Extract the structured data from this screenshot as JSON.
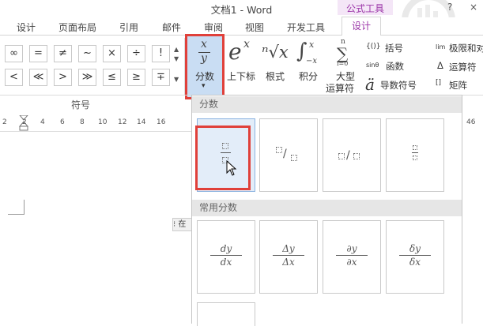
{
  "window": {
    "title": "文档1 - Word",
    "minimize": "?",
    "close": "×"
  },
  "contextual_tab_group": "公式工具",
  "tabs": [
    {
      "label": "设计"
    },
    {
      "label": "页面布局"
    },
    {
      "label": "引用"
    },
    {
      "label": "邮件"
    },
    {
      "label": "审阅"
    },
    {
      "label": "视图"
    },
    {
      "label": "开发工具"
    },
    {
      "label": "设计"
    }
  ],
  "symbols": {
    "row1": [
      "∞",
      "=",
      "≠",
      "~",
      "×",
      "÷",
      "!"
    ],
    "row2": [
      "<",
      "≪",
      ">",
      "≫",
      "≤",
      "≥",
      "∓"
    ],
    "group_label": "符号"
  },
  "structures": {
    "fraction": {
      "glyph_num": "x",
      "glyph_den": "y",
      "label": "分数",
      "arrow": "▾"
    },
    "script": {
      "label": "上下标",
      "glyph": "e",
      "sup": "x"
    },
    "radical": {
      "label": "根式",
      "glyph": "ⁿ√x"
    },
    "integral": {
      "label": "积分",
      "glyph": "∫",
      "sup": "x",
      "sub": "−x"
    },
    "large_operator": {
      "label1": "大型",
      "label2": "运算符",
      "glyph": "∑",
      "sup": "n",
      "sub": "i=0"
    },
    "small": [
      {
        "glyph": "{()}",
        "label": "括号"
      },
      {
        "glyph": "sinθ",
        "label": "函数"
      },
      {
        "glyph": "ä",
        "label": "导数符号"
      }
    ],
    "right": [
      {
        "glyph": "lim",
        "label": "极限和对"
      },
      {
        "glyph": "Δ",
        "label": "运算符"
      },
      {
        "glyph": "[]",
        "label": "矩阵"
      }
    ]
  },
  "ruler": [
    "2",
    "2",
    "4",
    "6",
    "8",
    "10",
    "12",
    "14",
    "16"
  ],
  "ruler_right": "46",
  "dropdown": {
    "section1": "分数",
    "section2": "常用分数",
    "common": [
      {
        "num": "dy",
        "den": "dx"
      },
      {
        "num": "Δy",
        "den": "Δx"
      },
      {
        "num": "∂y",
        "den": "∂x"
      },
      {
        "num": "δy",
        "den": "δx"
      }
    ]
  },
  "side_toolbar": "⁝ 在"
}
